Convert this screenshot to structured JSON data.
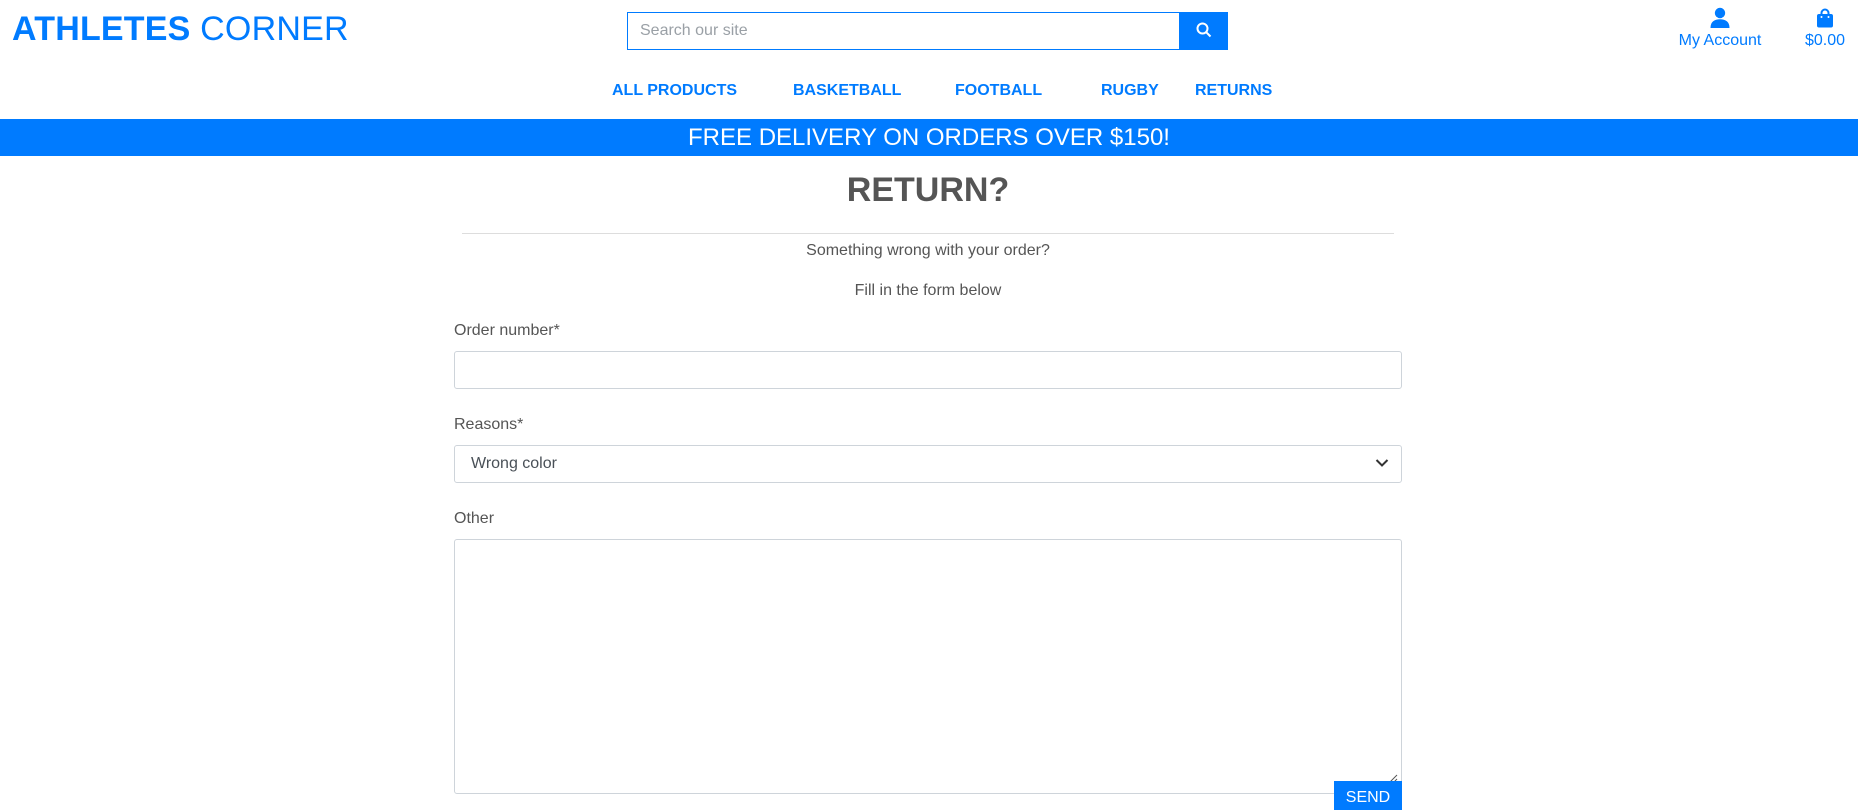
{
  "brand": {
    "name_bold": "ATHLETES",
    "name_regular": " CORNER"
  },
  "search": {
    "placeholder": "Search our site",
    "icon": "search-icon"
  },
  "header": {
    "account_label": "My Account",
    "account_icon": "user-icon",
    "bag_total": "$0.00",
    "bag_icon": "shopping-bag-icon"
  },
  "nav": {
    "items": [
      {
        "label": "ALL PRODUCTS"
      },
      {
        "label": "BASKETBALL"
      },
      {
        "label": "FOOTBALL"
      },
      {
        "label": "RUGBY"
      },
      {
        "label": "RETURNS"
      }
    ]
  },
  "banner": {
    "text": "FREE DELIVERY ON ORDERS OVER $150!"
  },
  "page": {
    "title": "RETURN?",
    "subtitle": "Something wrong with your order?",
    "instruction": "Fill in the form below"
  },
  "form": {
    "order_label": "Order number*",
    "order_value": "",
    "reasons_label": "Reasons*",
    "reasons_selected": "Wrong color",
    "other_label": "Other",
    "other_value": "",
    "send_label": "SEND"
  },
  "colors": {
    "accent": "#007bff",
    "text": "#555555",
    "border": "#ced4da"
  }
}
